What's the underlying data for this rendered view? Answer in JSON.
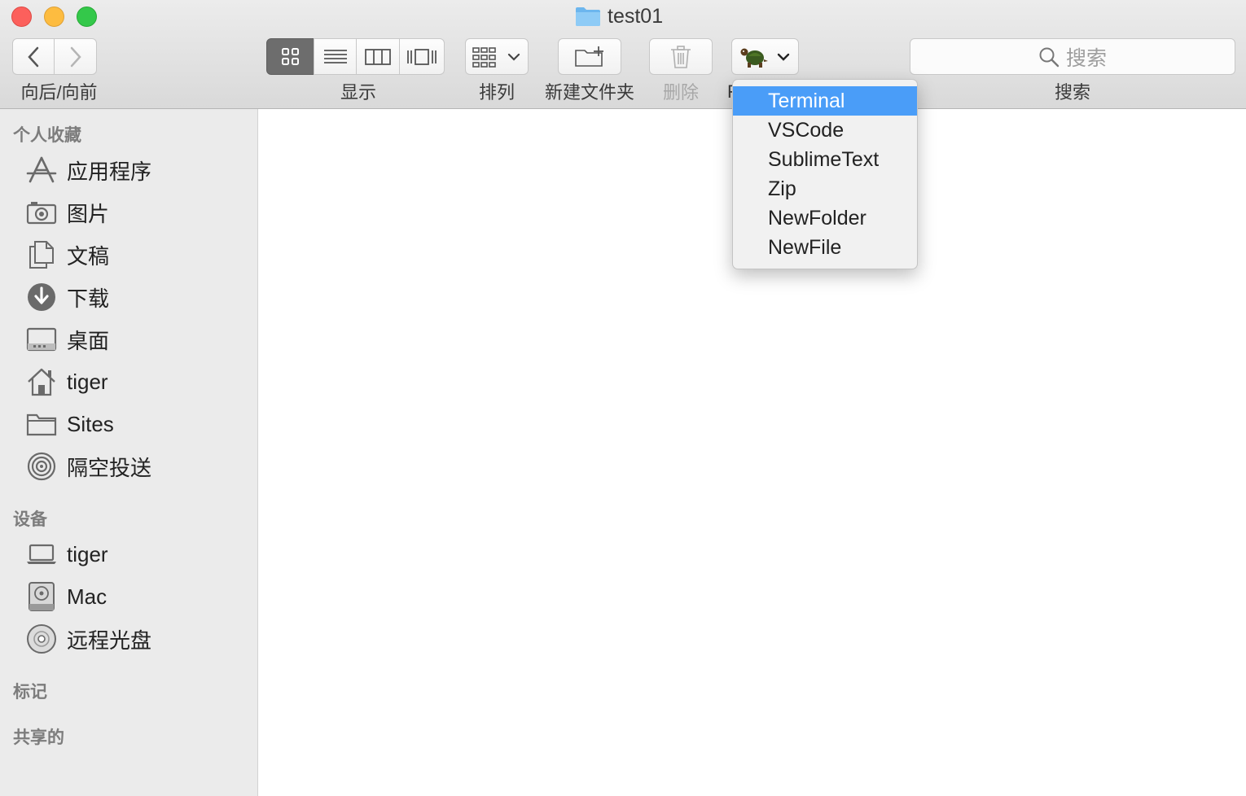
{
  "window": {
    "title": "test01"
  },
  "toolbar": {
    "nav_label": "向后/向前",
    "view_label": "显示",
    "arrange_label": "排列",
    "newfolder_label": "新建文件夹",
    "delete_label": "删除",
    "search_label": "搜索",
    "search_placeholder": "搜索",
    "hidden_label_first_char": "F"
  },
  "sidebar": {
    "favorites_header": "个人收藏",
    "favorites": [
      {
        "label": "应用程序",
        "icon": "applications-icon"
      },
      {
        "label": "图片",
        "icon": "camera-icon"
      },
      {
        "label": "文稿",
        "icon": "documents-icon"
      },
      {
        "label": "下载",
        "icon": "download-icon"
      },
      {
        "label": "桌面",
        "icon": "desktop-icon"
      },
      {
        "label": "tiger",
        "icon": "home-icon"
      },
      {
        "label": "Sites",
        "icon": "folder-icon"
      },
      {
        "label": "隔空投送",
        "icon": "airdrop-icon"
      }
    ],
    "devices_header": "设备",
    "devices": [
      {
        "label": "tiger",
        "icon": "laptop-icon"
      },
      {
        "label": "Mac",
        "icon": "disk-icon"
      },
      {
        "label": "远程光盘",
        "icon": "optical-disc-icon"
      }
    ],
    "tags_header": "标记",
    "shared_header": "共享的"
  },
  "dropdown": {
    "items": [
      "Terminal",
      "VSCode",
      "SublimeText",
      "Zip",
      "NewFolder",
      "NewFile"
    ],
    "selected": "Terminal"
  },
  "colors": {
    "selection": "#4a9df8",
    "sidebar_bg": "#ebebeb",
    "close": "#fc605c",
    "minimize": "#fdbc40",
    "zoom": "#34c84a"
  }
}
